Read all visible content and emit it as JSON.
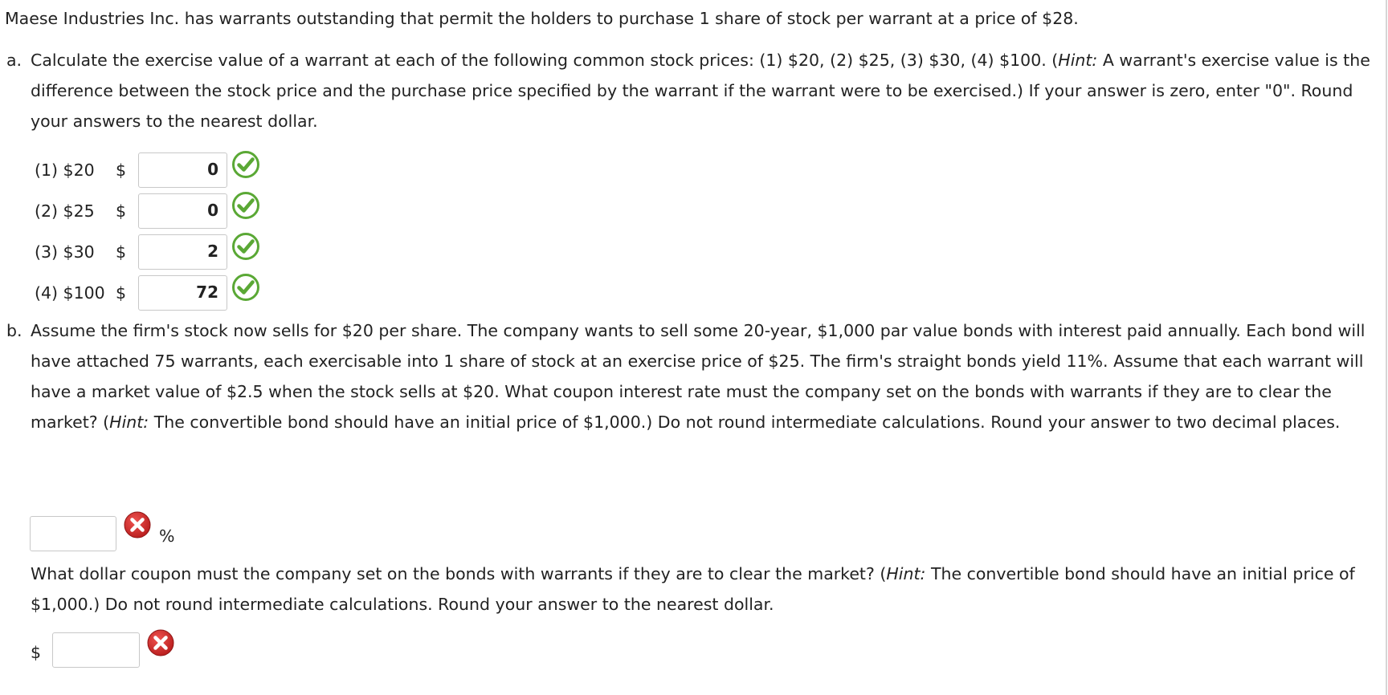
{
  "intro": "Maese Industries Inc. has warrants outstanding that permit the holders to purchase 1 share of stock per warrant at a price of $28.",
  "part_a": {
    "letter": "a.",
    "text_before_hint": "Calculate the exercise value of a warrant at each of the following common stock prices: (1) $20, (2) $25, (3) $30, (4) $100. (",
    "hint_label": "Hint:",
    "text_after_hint": " A warrant's exercise value is the difference between the stock price and the purchase price specified by the warrant if the warrant were to be exercised.) If your answer is zero, enter \"0\". Round your answers to the nearest dollar.",
    "rows": [
      {
        "label": "(1) $20",
        "currency": "$",
        "value": "0",
        "status": "correct"
      },
      {
        "label": "(2) $25",
        "currency": "$",
        "value": "0",
        "status": "correct"
      },
      {
        "label": "(3) $30",
        "currency": "$",
        "value": "2",
        "status": "correct"
      },
      {
        "label": "(4) $100",
        "currency": "$",
        "value": "72",
        "status": "correct"
      }
    ]
  },
  "part_b": {
    "letter": "b.",
    "text_before_hint": "Assume the firm's stock now sells for $20 per share. The company wants to sell some 20-year, $1,000 par value bonds with interest paid annually. Each bond will have attached 75 warrants, each exercisable into 1 share of stock at an exercise price of $25. The firm's straight bonds yield 11%. Assume that each warrant will have a market value of $2.5 when the stock sells at $20. What coupon interest rate must the company set on the bonds with warrants if they are to clear the market? (",
    "hint_label": "Hint:",
    "text_after_hint": " The convertible bond should have an initial price of $1,000.) Do not round intermediate calculations. Round your answer to two decimal places.",
    "rate_input": {
      "value": "",
      "status": "incorrect",
      "unit": "%"
    },
    "followup_before_hint": "What dollar coupon must the company set on the bonds with warrants if they are to clear the market? (",
    "followup_hint_label": "Hint:",
    "followup_after_hint": " The convertible bond should have an initial price of $1,000.) Do not round intermediate calculations. Round your answer to the nearest dollar.",
    "coupon_input": {
      "currency": "$",
      "value": "",
      "status": "incorrect"
    }
  },
  "colors": {
    "correct": "#5aa835",
    "incorrect": "#c62828",
    "border": "#c8c8c8"
  },
  "icons": {
    "correct": "check-circle-icon",
    "incorrect": "x-circle-icon"
  }
}
